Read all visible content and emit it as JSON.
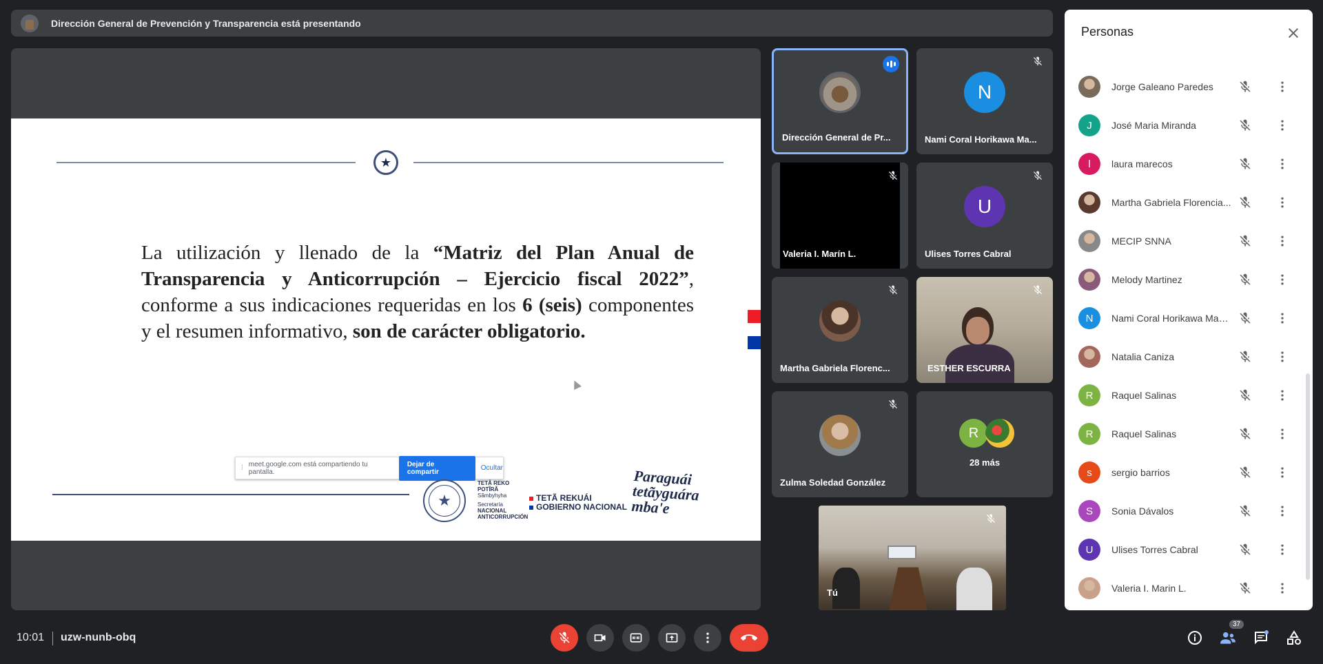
{
  "presenting": {
    "text": "Dirección General de Prevención y Transparencia está presentando"
  },
  "slide": {
    "text_normal_1": "La utilización y llenado de la ",
    "text_bold_1": "“Matriz del Plan Anual de Transparencia y Anticorrupción – Ejercicio fiscal 2022”",
    "text_normal_2": ", conforme a sus indicaciones requeridas en los ",
    "text_bold_2": "6 (seis)",
    "text_normal_3": " componentes y el resumen informativo, ",
    "text_bold_3": "son de carácter obligatorio.",
    "logo_senac_line1": "TETÃ REKO",
    "logo_senac_line2": "POTĨRÃ",
    "logo_senac_line3": "Sãmbyhyha",
    "logo_senac_line4": "Secretaría",
    "logo_senac_line5": "NACIONAL",
    "logo_senac_line6": "ANTICORRUPCIÓN",
    "logo_teta_line1": "TETÃ REKUÁI",
    "logo_teta_line2": "GOBIERNO NACIONAL",
    "logo_paraguai": "Paraguái tetãyguára mba'e"
  },
  "share_pill": {
    "message": "meet.google.com está compartiendo tu pantalla.",
    "stop_label": "Dejar de compartir",
    "hide_label": "Ocultar"
  },
  "tiles": [
    {
      "name": "Dirección General de Pr...",
      "speaking": true
    },
    {
      "name": "Nami Coral Horikawa Ma...",
      "initial": "N",
      "color": "#1a8ee0"
    },
    {
      "name": "Valeria I. Marín L."
    },
    {
      "name": "Ulises Torres Cabral",
      "initial": "U",
      "color": "#5e35b1"
    },
    {
      "name": "Martha Gabriela Florenc..."
    },
    {
      "name": "ESTHER ESCURRA"
    },
    {
      "name": "Zulma Soledad González"
    },
    {
      "name": "28 más",
      "initial": "R",
      "color": "#7cb342"
    },
    {
      "name": "Tú"
    }
  ],
  "people": {
    "title": "Personas",
    "list": [
      {
        "name": "Jorge Galeano Paredes",
        "initial": "",
        "color": "#7a6a5a"
      },
      {
        "name": "José Maria Miranda",
        "initial": "J",
        "color": "#12a38a"
      },
      {
        "name": "laura marecos",
        "initial": "l",
        "color": "#d81b60"
      },
      {
        "name": "Martha Gabriela Florencia...",
        "initial": "",
        "color": "#5a3a2e"
      },
      {
        "name": "MECIP SNNA",
        "initial": "",
        "color": "#888"
      },
      {
        "name": "Melody Martinez",
        "initial": "",
        "color": "#8a5a7a"
      },
      {
        "name": "Nami Coral Horikawa Man...",
        "initial": "N",
        "color": "#1a8ee0"
      },
      {
        "name": "Natalia Caniza",
        "initial": "",
        "color": "#a2675a"
      },
      {
        "name": "Raquel Salinas",
        "initial": "R",
        "color": "#7cb342"
      },
      {
        "name": "Raquel Salinas",
        "initial": "R",
        "color": "#7cb342"
      },
      {
        "name": "sergio barrios",
        "initial": "s",
        "color": "#e64a19"
      },
      {
        "name": "Sonia Dávalos",
        "initial": "S",
        "color": "#ab47bc"
      },
      {
        "name": "Ulises Torres Cabral",
        "initial": "U",
        "color": "#5e35b1"
      },
      {
        "name": "Valeria I. Marin L.",
        "initial": "",
        "color": "#c9a08a"
      }
    ]
  },
  "bottom_bar": {
    "time": "10:01",
    "meeting_code": "uzw-nunb-obq",
    "participants_count": "37"
  }
}
